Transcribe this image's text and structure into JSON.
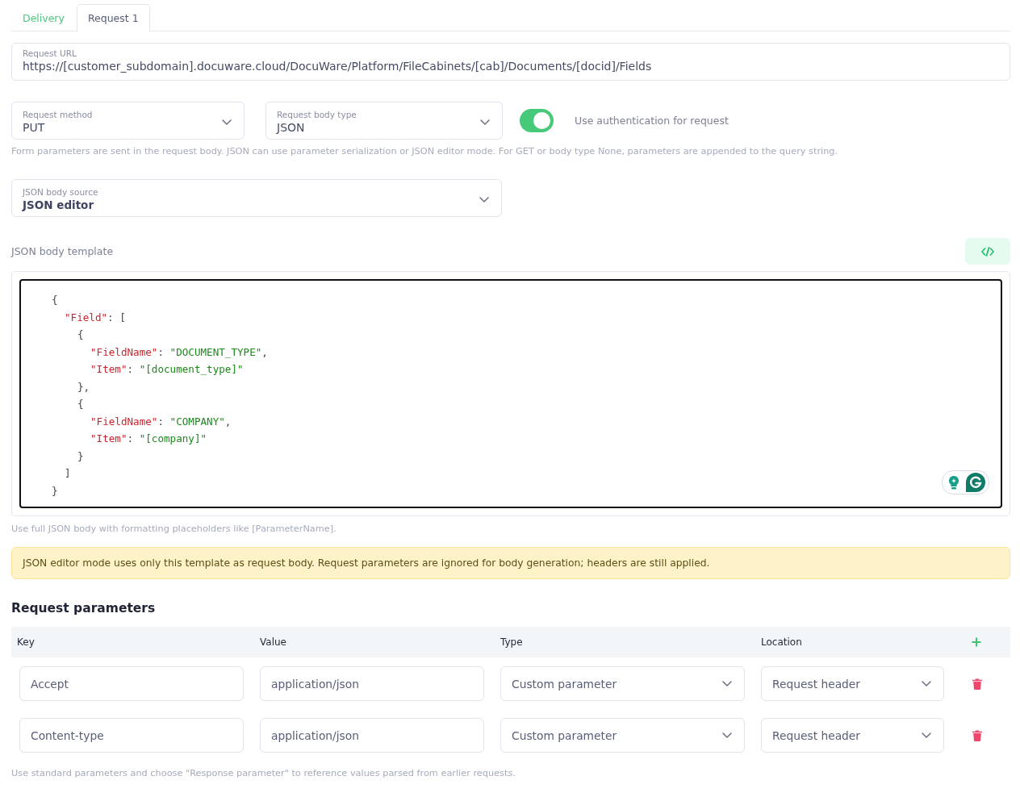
{
  "tabs": [
    {
      "label": "Delivery",
      "selected": false
    },
    {
      "label": "Request 1",
      "selected": true
    }
  ],
  "request_url": {
    "label": "Request URL",
    "value": "https://[customer_subdomain].docuware.cloud/DocuWare/Platform/FileCabinets/[cab]/Documents/[docid]/Fields"
  },
  "request_method": {
    "label": "Request method",
    "value": "PUT"
  },
  "request_body_type": {
    "label": "Request body type",
    "value": "JSON"
  },
  "authentication": {
    "label": "Use authentication for request",
    "on": true
  },
  "request_hint": "Form parameters are sent in the request body. JSON can use parameter serialization or JSON editor mode. For GET or body type None, parameters are appended to the query string.",
  "json_body_source": {
    "label": "JSON body source",
    "value": "JSON editor"
  },
  "json_body_template": {
    "label": "JSON body template",
    "lines": [
      {
        "tokens": [
          {
            "text": "{",
            "kind": "punct"
          }
        ],
        "children": [
          {
            "tokens": [
              {
                "text": "\"Field\"",
                "kind": "key"
              },
              {
                "text": ": [",
                "kind": "punct"
              }
            ],
            "children": [
              {
                "tokens": [
                  {
                    "text": "{",
                    "kind": "punct"
                  }
                ],
                "children": [
                  {
                    "tokens": [
                      {
                        "text": "\"FieldName\"",
                        "kind": "key"
                      },
                      {
                        "text": ": ",
                        "kind": "punct"
                      },
                      {
                        "text": "\"DOCUMENT_TYPE\"",
                        "kind": "string"
                      },
                      {
                        "text": ",",
                        "kind": "punct"
                      }
                    ]
                  },
                  {
                    "tokens": [
                      {
                        "text": "\"Item\"",
                        "kind": "key"
                      },
                      {
                        "text": ": ",
                        "kind": "punct"
                      },
                      {
                        "text": "\"[document_type]\"",
                        "kind": "string"
                      }
                    ]
                  }
                ]
              },
              {
                "tokens": [
                  {
                    "text": "},",
                    "kind": "punct"
                  }
                ]
              },
              {
                "tokens": [
                  {
                    "text": "{",
                    "kind": "punct"
                  }
                ],
                "children": [
                  {
                    "tokens": [
                      {
                        "text": "\"FieldName\"",
                        "kind": "key"
                      },
                      {
                        "text": ": ",
                        "kind": "punct"
                      },
                      {
                        "text": "\"COMPANY\"",
                        "kind": "string"
                      },
                      {
                        "text": ",",
                        "kind": "punct"
                      }
                    ]
                  },
                  {
                    "tokens": [
                      {
                        "text": "\"Item\"",
                        "kind": "key"
                      },
                      {
                        "text": ": ",
                        "kind": "punct"
                      },
                      {
                        "text": "\"[company]\"",
                        "kind": "string"
                      }
                    ]
                  }
                ]
              },
              {
                "tokens": [
                  {
                    "text": "}",
                    "kind": "punct"
                  }
                ]
              }
            ]
          },
          {
            "tokens": [
              {
                "text": "]",
                "kind": "punct"
              }
            ]
          }
        ]
      },
      {
        "tokens": [
          {
            "text": "}",
            "kind": "punct"
          }
        ]
      }
    ],
    "hint": "Use full JSON body with formatting placeholders like [ParameterName]."
  },
  "notice": "JSON editor mode uses only this template as request body. Request parameters are ignored for body generation; headers are still applied.",
  "request_parameters": {
    "title": "Request parameters",
    "columns": [
      "Key",
      "Value",
      "Type",
      "Location"
    ],
    "rows": [
      {
        "key": "Accept",
        "value": "application/json",
        "type": "Custom parameter",
        "location": "Request header"
      },
      {
        "key": "Content-type",
        "value": "application/json",
        "type": "Custom parameter",
        "location": "Request header"
      }
    ],
    "hint": "Use standard parameters and choose \"Response parameter\" to reference values parsed from earlier requests."
  }
}
